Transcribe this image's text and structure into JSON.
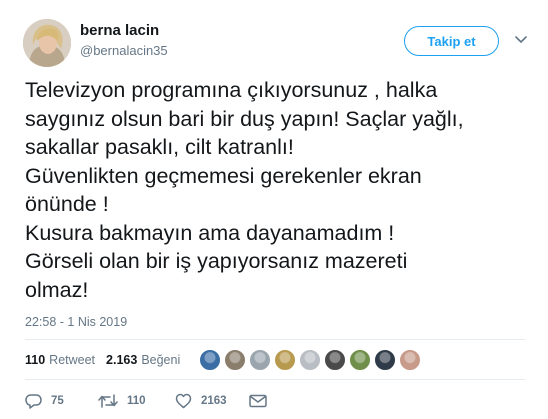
{
  "user": {
    "name": "berna lacin",
    "handle": "@bernalacin35",
    "follow_label": "Takip et"
  },
  "tweet": {
    "text": "Televizyon programına çıkıyorsunuz , halka\nsaygınız olsun bari bir duş yapın! Saçlar yağlı,\nsakallar pasaklı, cilt katranlı!\nGüvenlikten geçmemesi gerekenler ekran\nönünde !\nKusura bakmayın ama dayanamadım !\nGörseli olan bir iş yapıyorsanız mazereti\nolmaz!",
    "timestamp": "22:58 - 1 Nis 2019"
  },
  "stats": {
    "retweets": "110",
    "retweets_label": "Retweet",
    "likes": "2.163",
    "likes_label": "Beğeni",
    "liker_colors": [
      "#3b6ea5",
      "#8a7d6b",
      "#9aa5ad",
      "#b89a4e",
      "#b8bec4",
      "#4a4a4a",
      "#6f8f4a",
      "#2f3b48",
      "#c79a8a"
    ]
  },
  "actions": {
    "reply_count": "75",
    "retweet_count": "110",
    "like_count": "2163"
  },
  "colors": {
    "accent": "#1da1f2",
    "secondary_text": "#657786",
    "divider": "#e6ecf0"
  },
  "icons": [
    "chevron-down-icon",
    "reply-icon",
    "retweet-icon",
    "heart-icon",
    "mail-icon"
  ]
}
